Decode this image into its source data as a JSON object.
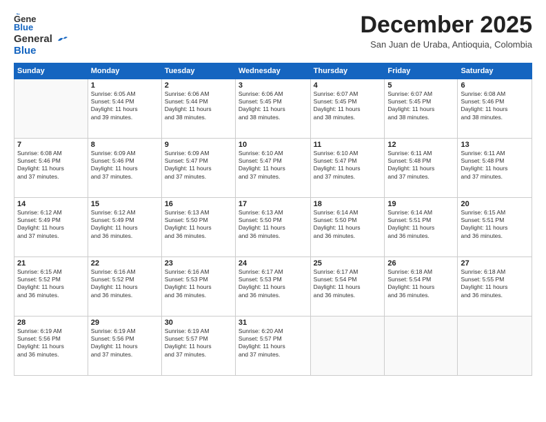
{
  "logo": {
    "general": "General",
    "blue": "Blue"
  },
  "title": "December 2025",
  "location": "San Juan de Uraba, Antioquia, Colombia",
  "days_of_week": [
    "Sunday",
    "Monday",
    "Tuesday",
    "Wednesday",
    "Thursday",
    "Friday",
    "Saturday"
  ],
  "weeks": [
    [
      {
        "day": "",
        "info": ""
      },
      {
        "day": "1",
        "info": "Sunrise: 6:05 AM\nSunset: 5:44 PM\nDaylight: 11 hours\nand 39 minutes."
      },
      {
        "day": "2",
        "info": "Sunrise: 6:06 AM\nSunset: 5:44 PM\nDaylight: 11 hours\nand 38 minutes."
      },
      {
        "day": "3",
        "info": "Sunrise: 6:06 AM\nSunset: 5:45 PM\nDaylight: 11 hours\nand 38 minutes."
      },
      {
        "day": "4",
        "info": "Sunrise: 6:07 AM\nSunset: 5:45 PM\nDaylight: 11 hours\nand 38 minutes."
      },
      {
        "day": "5",
        "info": "Sunrise: 6:07 AM\nSunset: 5:45 PM\nDaylight: 11 hours\nand 38 minutes."
      },
      {
        "day": "6",
        "info": "Sunrise: 6:08 AM\nSunset: 5:46 PM\nDaylight: 11 hours\nand 38 minutes."
      }
    ],
    [
      {
        "day": "7",
        "info": "Sunrise: 6:08 AM\nSunset: 5:46 PM\nDaylight: 11 hours\nand 37 minutes."
      },
      {
        "day": "8",
        "info": "Sunrise: 6:09 AM\nSunset: 5:46 PM\nDaylight: 11 hours\nand 37 minutes."
      },
      {
        "day": "9",
        "info": "Sunrise: 6:09 AM\nSunset: 5:47 PM\nDaylight: 11 hours\nand 37 minutes."
      },
      {
        "day": "10",
        "info": "Sunrise: 6:10 AM\nSunset: 5:47 PM\nDaylight: 11 hours\nand 37 minutes."
      },
      {
        "day": "11",
        "info": "Sunrise: 6:10 AM\nSunset: 5:47 PM\nDaylight: 11 hours\nand 37 minutes."
      },
      {
        "day": "12",
        "info": "Sunrise: 6:11 AM\nSunset: 5:48 PM\nDaylight: 11 hours\nand 37 minutes."
      },
      {
        "day": "13",
        "info": "Sunrise: 6:11 AM\nSunset: 5:48 PM\nDaylight: 11 hours\nand 37 minutes."
      }
    ],
    [
      {
        "day": "14",
        "info": "Sunrise: 6:12 AM\nSunset: 5:49 PM\nDaylight: 11 hours\nand 37 minutes."
      },
      {
        "day": "15",
        "info": "Sunrise: 6:12 AM\nSunset: 5:49 PM\nDaylight: 11 hours\nand 36 minutes."
      },
      {
        "day": "16",
        "info": "Sunrise: 6:13 AM\nSunset: 5:50 PM\nDaylight: 11 hours\nand 36 minutes."
      },
      {
        "day": "17",
        "info": "Sunrise: 6:13 AM\nSunset: 5:50 PM\nDaylight: 11 hours\nand 36 minutes."
      },
      {
        "day": "18",
        "info": "Sunrise: 6:14 AM\nSunset: 5:50 PM\nDaylight: 11 hours\nand 36 minutes."
      },
      {
        "day": "19",
        "info": "Sunrise: 6:14 AM\nSunset: 5:51 PM\nDaylight: 11 hours\nand 36 minutes."
      },
      {
        "day": "20",
        "info": "Sunrise: 6:15 AM\nSunset: 5:51 PM\nDaylight: 11 hours\nand 36 minutes."
      }
    ],
    [
      {
        "day": "21",
        "info": "Sunrise: 6:15 AM\nSunset: 5:52 PM\nDaylight: 11 hours\nand 36 minutes."
      },
      {
        "day": "22",
        "info": "Sunrise: 6:16 AM\nSunset: 5:52 PM\nDaylight: 11 hours\nand 36 minutes."
      },
      {
        "day": "23",
        "info": "Sunrise: 6:16 AM\nSunset: 5:53 PM\nDaylight: 11 hours\nand 36 minutes."
      },
      {
        "day": "24",
        "info": "Sunrise: 6:17 AM\nSunset: 5:53 PM\nDaylight: 11 hours\nand 36 minutes."
      },
      {
        "day": "25",
        "info": "Sunrise: 6:17 AM\nSunset: 5:54 PM\nDaylight: 11 hours\nand 36 minutes."
      },
      {
        "day": "26",
        "info": "Sunrise: 6:18 AM\nSunset: 5:54 PM\nDaylight: 11 hours\nand 36 minutes."
      },
      {
        "day": "27",
        "info": "Sunrise: 6:18 AM\nSunset: 5:55 PM\nDaylight: 11 hours\nand 36 minutes."
      }
    ],
    [
      {
        "day": "28",
        "info": "Sunrise: 6:19 AM\nSunset: 5:56 PM\nDaylight: 11 hours\nand 36 minutes."
      },
      {
        "day": "29",
        "info": "Sunrise: 6:19 AM\nSunset: 5:56 PM\nDaylight: 11 hours\nand 37 minutes."
      },
      {
        "day": "30",
        "info": "Sunrise: 6:19 AM\nSunset: 5:57 PM\nDaylight: 11 hours\nand 37 minutes."
      },
      {
        "day": "31",
        "info": "Sunrise: 6:20 AM\nSunset: 5:57 PM\nDaylight: 11 hours\nand 37 minutes."
      },
      {
        "day": "",
        "info": ""
      },
      {
        "day": "",
        "info": ""
      },
      {
        "day": "",
        "info": ""
      }
    ]
  ]
}
